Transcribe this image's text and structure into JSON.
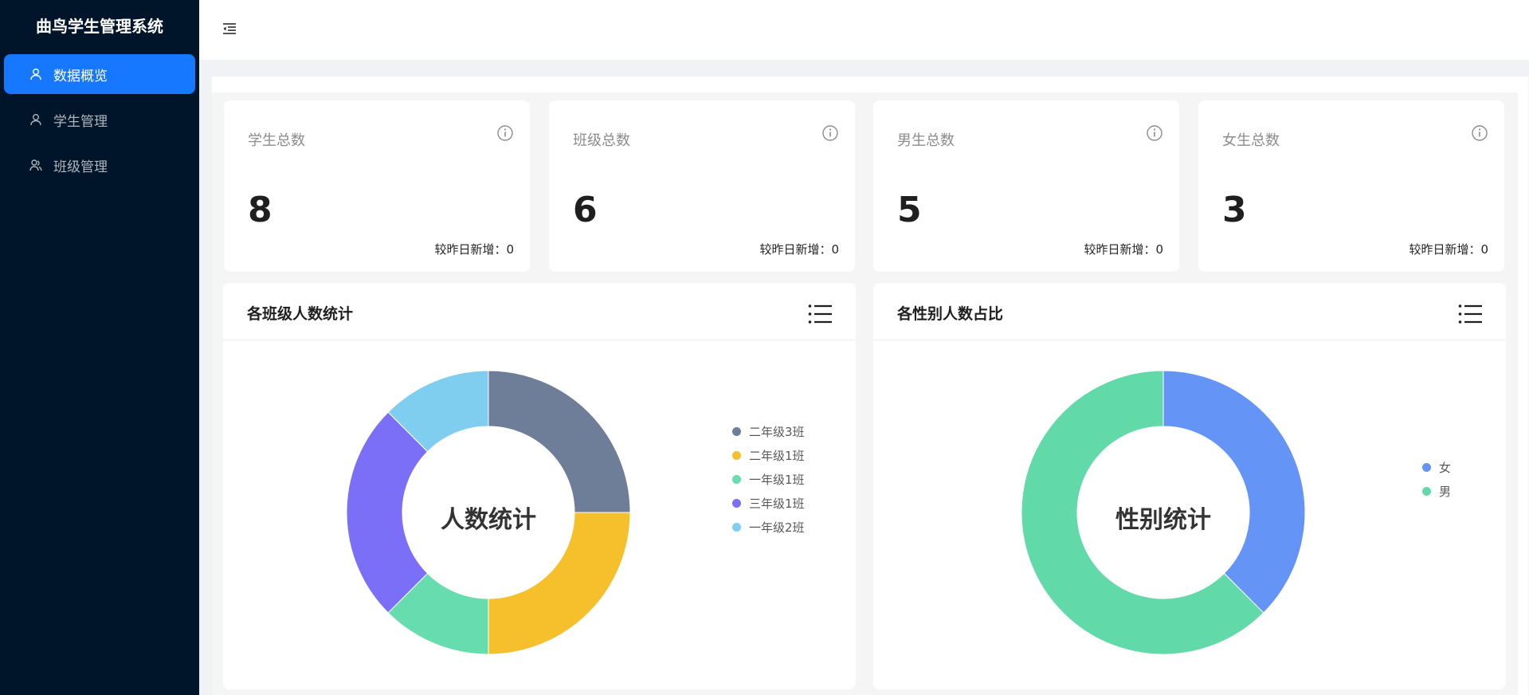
{
  "app": {
    "title": "曲鸟学生管理系统"
  },
  "sidebar": {
    "items": [
      {
        "label": "数据概览",
        "icon": "user-icon",
        "active": true
      },
      {
        "label": "学生管理",
        "icon": "user-icon",
        "active": false
      },
      {
        "label": "班级管理",
        "icon": "team-icon",
        "active": false
      }
    ]
  },
  "stats": [
    {
      "title": "学生总数",
      "value": "8",
      "foot": "较昨日新增：0"
    },
    {
      "title": "班级总数",
      "value": "6",
      "foot": "较昨日新增：0"
    },
    {
      "title": "男生总数",
      "value": "5",
      "foot": "较昨日新增：0"
    },
    {
      "title": "女生总数",
      "value": "3",
      "foot": "较昨日新增：0"
    }
  ],
  "class_chart": {
    "title": "各班级人数统计",
    "center": "人数统计"
  },
  "gender_chart": {
    "title": "各性别人数占比",
    "center": "性别统计"
  },
  "chart_data": [
    {
      "type": "pie",
      "title": "各班级人数统计",
      "donut": true,
      "legend_position": "right",
      "categories": [
        "二年级3班",
        "二年级1班",
        "一年级1班",
        "三年级1班",
        "一年级2班"
      ],
      "values": [
        2,
        2,
        1,
        2,
        1
      ],
      "colors": [
        "#6e7e99",
        "#f5c02c",
        "#67dcae",
        "#7b6ff7",
        "#7fcdef"
      ]
    },
    {
      "type": "pie",
      "title": "各性别人数占比",
      "donut": true,
      "legend_position": "right",
      "categories": [
        "女",
        "男"
      ],
      "values": [
        3,
        5
      ],
      "colors": [
        "#6495f6",
        "#62d9a9"
      ]
    }
  ]
}
